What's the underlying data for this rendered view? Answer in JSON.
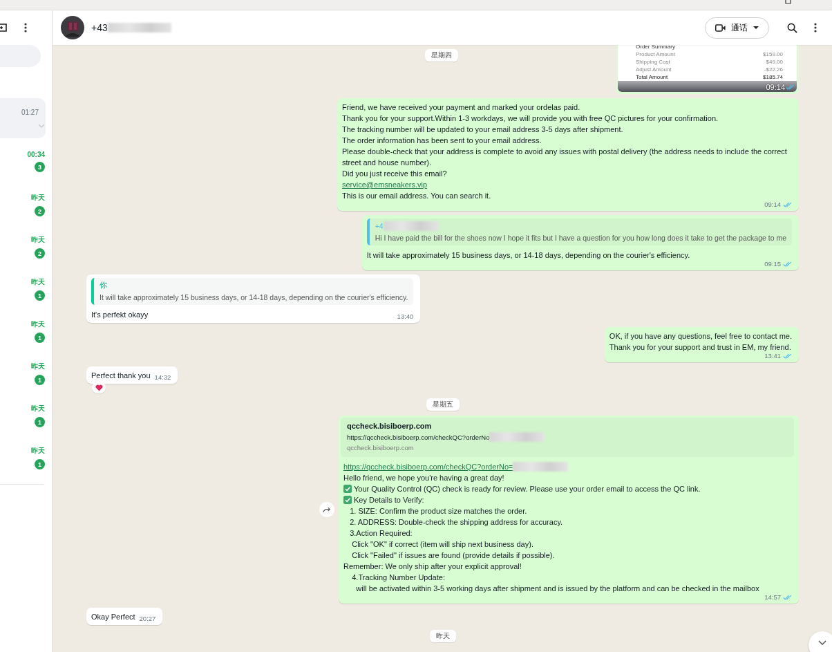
{
  "sidebar": {
    "chats": [
      {
        "time": "01:27",
        "selected": true
      },
      {
        "time": "00:34",
        "unread": "3",
        "selected": false
      },
      {
        "time": "昨天",
        "unread": "2",
        "selected": false
      },
      {
        "time": "昨天",
        "unread": "2",
        "selected": false
      },
      {
        "time": "昨天",
        "unread": "1",
        "selected": false
      },
      {
        "time": "昨天",
        "unread": "1",
        "selected": false
      },
      {
        "time": "昨天",
        "unread": "1",
        "selected": false
      },
      {
        "time": "昨天",
        "unread": "1",
        "selected": false
      },
      {
        "time": "昨天",
        "unread": "1",
        "selected": false
      }
    ]
  },
  "header": {
    "contact": {
      "text": "+43",
      "redacted": true
    },
    "call_button": "通话"
  },
  "sticky_date": "星期四",
  "messages": [
    {
      "time": "09:14",
      "read": true,
      "reacted": false,
      "forward_button": false,
      "image": {
        "title": "Order Summary",
        "rows": [
          {
            "label": "Product Amount",
            "value": "$159.00"
          },
          {
            "label": "Shipping Cost",
            "value": "$49.00"
          },
          {
            "label": "Adjust Amount",
            "value": "-$22.26"
          },
          {
            "label": "Total Amount",
            "value": "$185.74"
          }
        ]
      }
    },
    {
      "kind": "outgoing",
      "time": "09:14",
      "read": true,
      "reacted": false,
      "forward_button": false,
      "lines": [
        {
          "kind": "text",
          "text": "Friend, we have received your payment and marked your ordelas paid."
        },
        {
          "kind": "text",
          "text": "Thank you for your support.Within 1-3 workdays, we will provide you with free QC pictures for your confirmation."
        },
        {
          "kind": "text",
          "text": "The tracking number will be updated to your email address 3-5 days after shipment."
        },
        {
          "kind": "text",
          "text": "The order information has been sent to your email address."
        },
        {
          "kind": "text",
          "text": "Please double-check that your address is complete to avoid any issues with postal delivery (the address needs to include the correct street and house number)."
        },
        {
          "kind": "text",
          "text": "Did you just receive this email?"
        },
        {
          "kind": "link",
          "text": "service@emsneakers.vip",
          "redacted": false
        },
        {
          "kind": "text",
          "text": "This is our email address. You can search it."
        }
      ]
    },
    {
      "kind": "outgoing",
      "time": "09:15",
      "read": true,
      "reacted": false,
      "forward_button": false,
      "quote": {
        "sender": "+4",
        "redacted": true,
        "text": "Hi I have paid the bill for the shoes now I hope it fits but I have a question for you how long does it take to get the package to me"
      },
      "lines": [
        {
          "kind": "text",
          "text": "It will take approximately 15 business days, or 14-18 days, depending on the courier's efficiency."
        }
      ]
    },
    {
      "kind": "incoming",
      "time": "13:40",
      "reacted": false,
      "forward_button": false,
      "quote": {
        "sender": "你",
        "redacted": false,
        "text": "It will take approximately 15 business days, or 14-18 days, depending on the courier's efficiency."
      },
      "lines": [
        {
          "kind": "text",
          "text": "It's perfekt okayy"
        }
      ]
    },
    {
      "kind": "outgoing",
      "time": "13:41",
      "read": true,
      "reacted": false,
      "forward_button": false,
      "lines": [
        {
          "kind": "text",
          "text": "OK, if you have any questions, feel free to contact me."
        },
        {
          "kind": "text",
          "text": "Thank you for your support and trust in EM, my friend."
        }
      ]
    },
    {
      "kind": "incoming",
      "time": "14:32",
      "reacted": true,
      "forward_button": false,
      "lines": [
        {
          "kind": "text",
          "text": "Perfect thank you"
        }
      ]
    },
    {
      "kind": "date",
      "text": "星期五"
    },
    {
      "kind": "outgoing",
      "time": "14:57",
      "read": true,
      "reacted": false,
      "forward_button": true,
      "preview": {
        "title": "qccheck.bisiboerp.com",
        "url": "https://qccheck.bisiboerp.com/checkQC?orderNo",
        "redacted": true,
        "domain": "qccheck.bisiboerp.com"
      },
      "lines": [
        {
          "kind": "link",
          "text": "https://qccheck.bisiboerp.com/checkQC?orderNo=",
          "redacted": true
        },
        {
          "kind": "text",
          "text": "Hello friend, we hope you're having a great day!"
        },
        {
          "kind": "check",
          "text": "Your Quality Control (QC) check is ready for review. Please use your order email to access the QC link."
        },
        {
          "kind": "check",
          "text": "Key Details to Verify:"
        },
        {
          "kind": "text",
          "text": "   1. SIZE: Confirm the product size matches the order."
        },
        {
          "kind": "text",
          "text": "   2. ADDRESS: Double-check the shipping address for accuracy."
        },
        {
          "kind": "text",
          "text": "   3.Action Required:"
        },
        {
          "kind": "text",
          "text": "    Click \"OK\" if correct (item will ship next business day)."
        },
        {
          "kind": "text",
          "text": "    Click \"Failed\" if issues are found (provide details if possible)."
        },
        {
          "kind": "text",
          "text": "Remember: We only ship after your explicit approval!"
        },
        {
          "kind": "text",
          "text": "    4.Tracking Number Update:"
        },
        {
          "kind": "text",
          "text": "      will be activated within 3-5 working days after shipment and is issued by the platform and can be checked in the mailbox"
        }
      ]
    },
    {
      "kind": "incoming",
      "time": "20:27",
      "reacted": false,
      "forward_button": false,
      "lines": [
        {
          "kind": "text",
          "text": "Okay Perfect"
        }
      ]
    },
    {
      "kind": "date",
      "text": "昨天"
    }
  ]
}
